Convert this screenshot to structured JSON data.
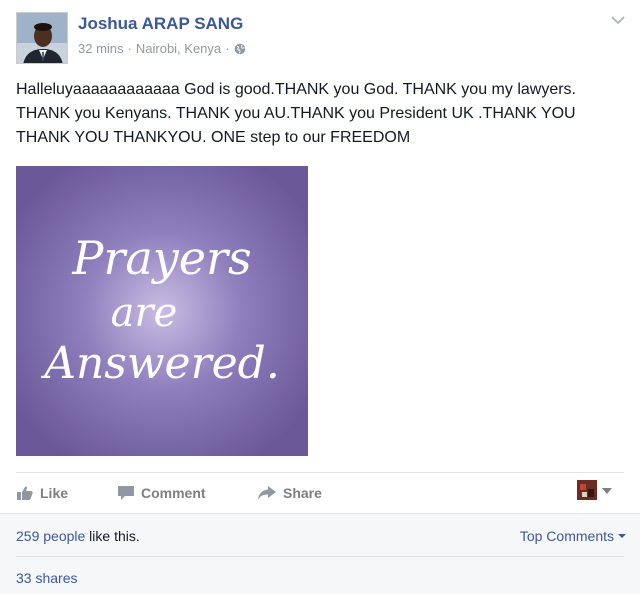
{
  "post": {
    "author": "Joshua ARAP SANG",
    "time": "32 mins",
    "separator": "·",
    "location": "Nairobi, Kenya",
    "message": "Halleluyaaaaaaaaaaaa God is good.THANK you God. THANK you my lawyers. THANK you Kenyans. THANK you AU.THANK you President UK .THANK YOU THANK YOU THANKYOU. ONE step to our FREEDOM",
    "image": {
      "line1": "Prayers",
      "line2": "are",
      "line3": "Answered.",
      "background": "#6b5a9b"
    }
  },
  "actions": {
    "like": "Like",
    "comment": "Comment",
    "share": "Share"
  },
  "ufi": {
    "likes_count": "259 people",
    "likes_suffix": " like this.",
    "top_comments": "Top Comments",
    "shares": "33 shares"
  },
  "colors": {
    "link": "#3b5998",
    "muted": "#9197a3",
    "action": "#7f7f7f"
  },
  "icons": {
    "globe": "globe-icon",
    "chevron": "chevron-down-icon",
    "like": "thumbs-up-icon",
    "comment": "comment-bubble-icon",
    "share": "share-arrow-icon",
    "caret": "caret-down-icon"
  }
}
